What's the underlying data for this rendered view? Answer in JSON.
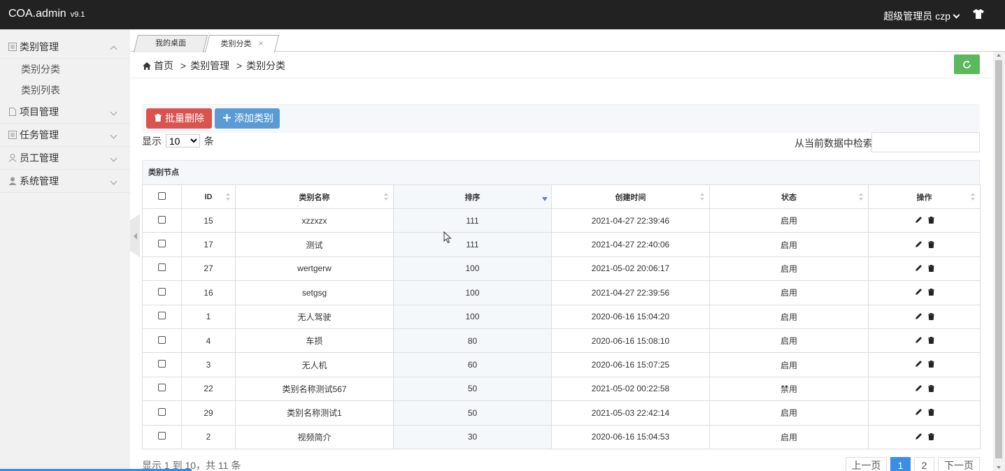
{
  "app": {
    "brand": "COA.admin",
    "version": "v9.1",
    "user_role": "超级管理员",
    "user_name": "czp"
  },
  "sidebar": {
    "items": [
      {
        "label": "类别管理",
        "icon": "list-icon",
        "expanded": true,
        "children": [
          {
            "label": "类别分类"
          },
          {
            "label": "类别列表"
          }
        ]
      },
      {
        "label": "项目管理",
        "icon": "file-icon",
        "expanded": false
      },
      {
        "label": "任务管理",
        "icon": "list-icon",
        "expanded": false
      },
      {
        "label": "员工管理",
        "icon": "user-outline-icon",
        "expanded": false
      },
      {
        "label": "系统管理",
        "icon": "user-icon",
        "expanded": false
      }
    ]
  },
  "tabs": [
    {
      "label": "我的桌面",
      "active": false
    },
    {
      "label": "类别分类",
      "active": true,
      "close": "×"
    }
  ],
  "breadcrumb": {
    "home": "首页",
    "sep": ">",
    "level1": "类别管理",
    "level2": "类别分类"
  },
  "toolbar": {
    "delete_label": "批量删除",
    "add_label": "添加类别"
  },
  "length_control": {
    "prefix": "显示",
    "value": "10",
    "suffix": "条"
  },
  "search": {
    "label": "从当前数据中检索:",
    "value": ""
  },
  "panel": {
    "title": "类别节点"
  },
  "table": {
    "columns": [
      "ID",
      "类别名称",
      "排序",
      "创建时间",
      "状态",
      "操作"
    ],
    "sorted_column": "排序",
    "sort_direction": "desc",
    "rows": [
      {
        "id": "15",
        "name": "xzzxzx",
        "sort": "111",
        "created": "2021-04-27 22:39:46",
        "status": "启用"
      },
      {
        "id": "17",
        "name": "测试",
        "sort": "111",
        "created": "2021-04-27 22:40:06",
        "status": "启用"
      },
      {
        "id": "27",
        "name": "wertgerw",
        "sort": "100",
        "created": "2021-05-02 20:06:17",
        "status": "启用"
      },
      {
        "id": "16",
        "name": "setgsg",
        "sort": "100",
        "created": "2021-04-27 22:39:56",
        "status": "启用"
      },
      {
        "id": "1",
        "name": "无人驾驶",
        "sort": "100",
        "created": "2020-06-16 15:04:20",
        "status": "启用"
      },
      {
        "id": "4",
        "name": "车损",
        "sort": "80",
        "created": "2020-06-16 15:08:10",
        "status": "启用"
      },
      {
        "id": "3",
        "name": "无人机",
        "sort": "60",
        "created": "2020-06-16 15:07:25",
        "status": "启用"
      },
      {
        "id": "22",
        "name": "类别名称测试567",
        "sort": "50",
        "created": "2021-05-02 00:22:58",
        "status": "禁用"
      },
      {
        "id": "29",
        "name": "类别名称测试1",
        "sort": "50",
        "created": "2021-05-03 22:42:14",
        "status": "启用"
      },
      {
        "id": "2",
        "name": "视频简介",
        "sort": "30",
        "created": "2020-06-16 15:04:53",
        "status": "启用"
      }
    ]
  },
  "footer": {
    "info": "显示 1 到 10，共 11 条",
    "pagination": {
      "prev": "上一页",
      "pages": [
        "1",
        "2"
      ],
      "current": "1",
      "next": "下一页"
    }
  },
  "colors": {
    "topbar": "#222222",
    "danger": "#d9534f",
    "primary": "#5b9bd5",
    "success": "#5cb85c",
    "page_active": "#3a8ee6"
  }
}
